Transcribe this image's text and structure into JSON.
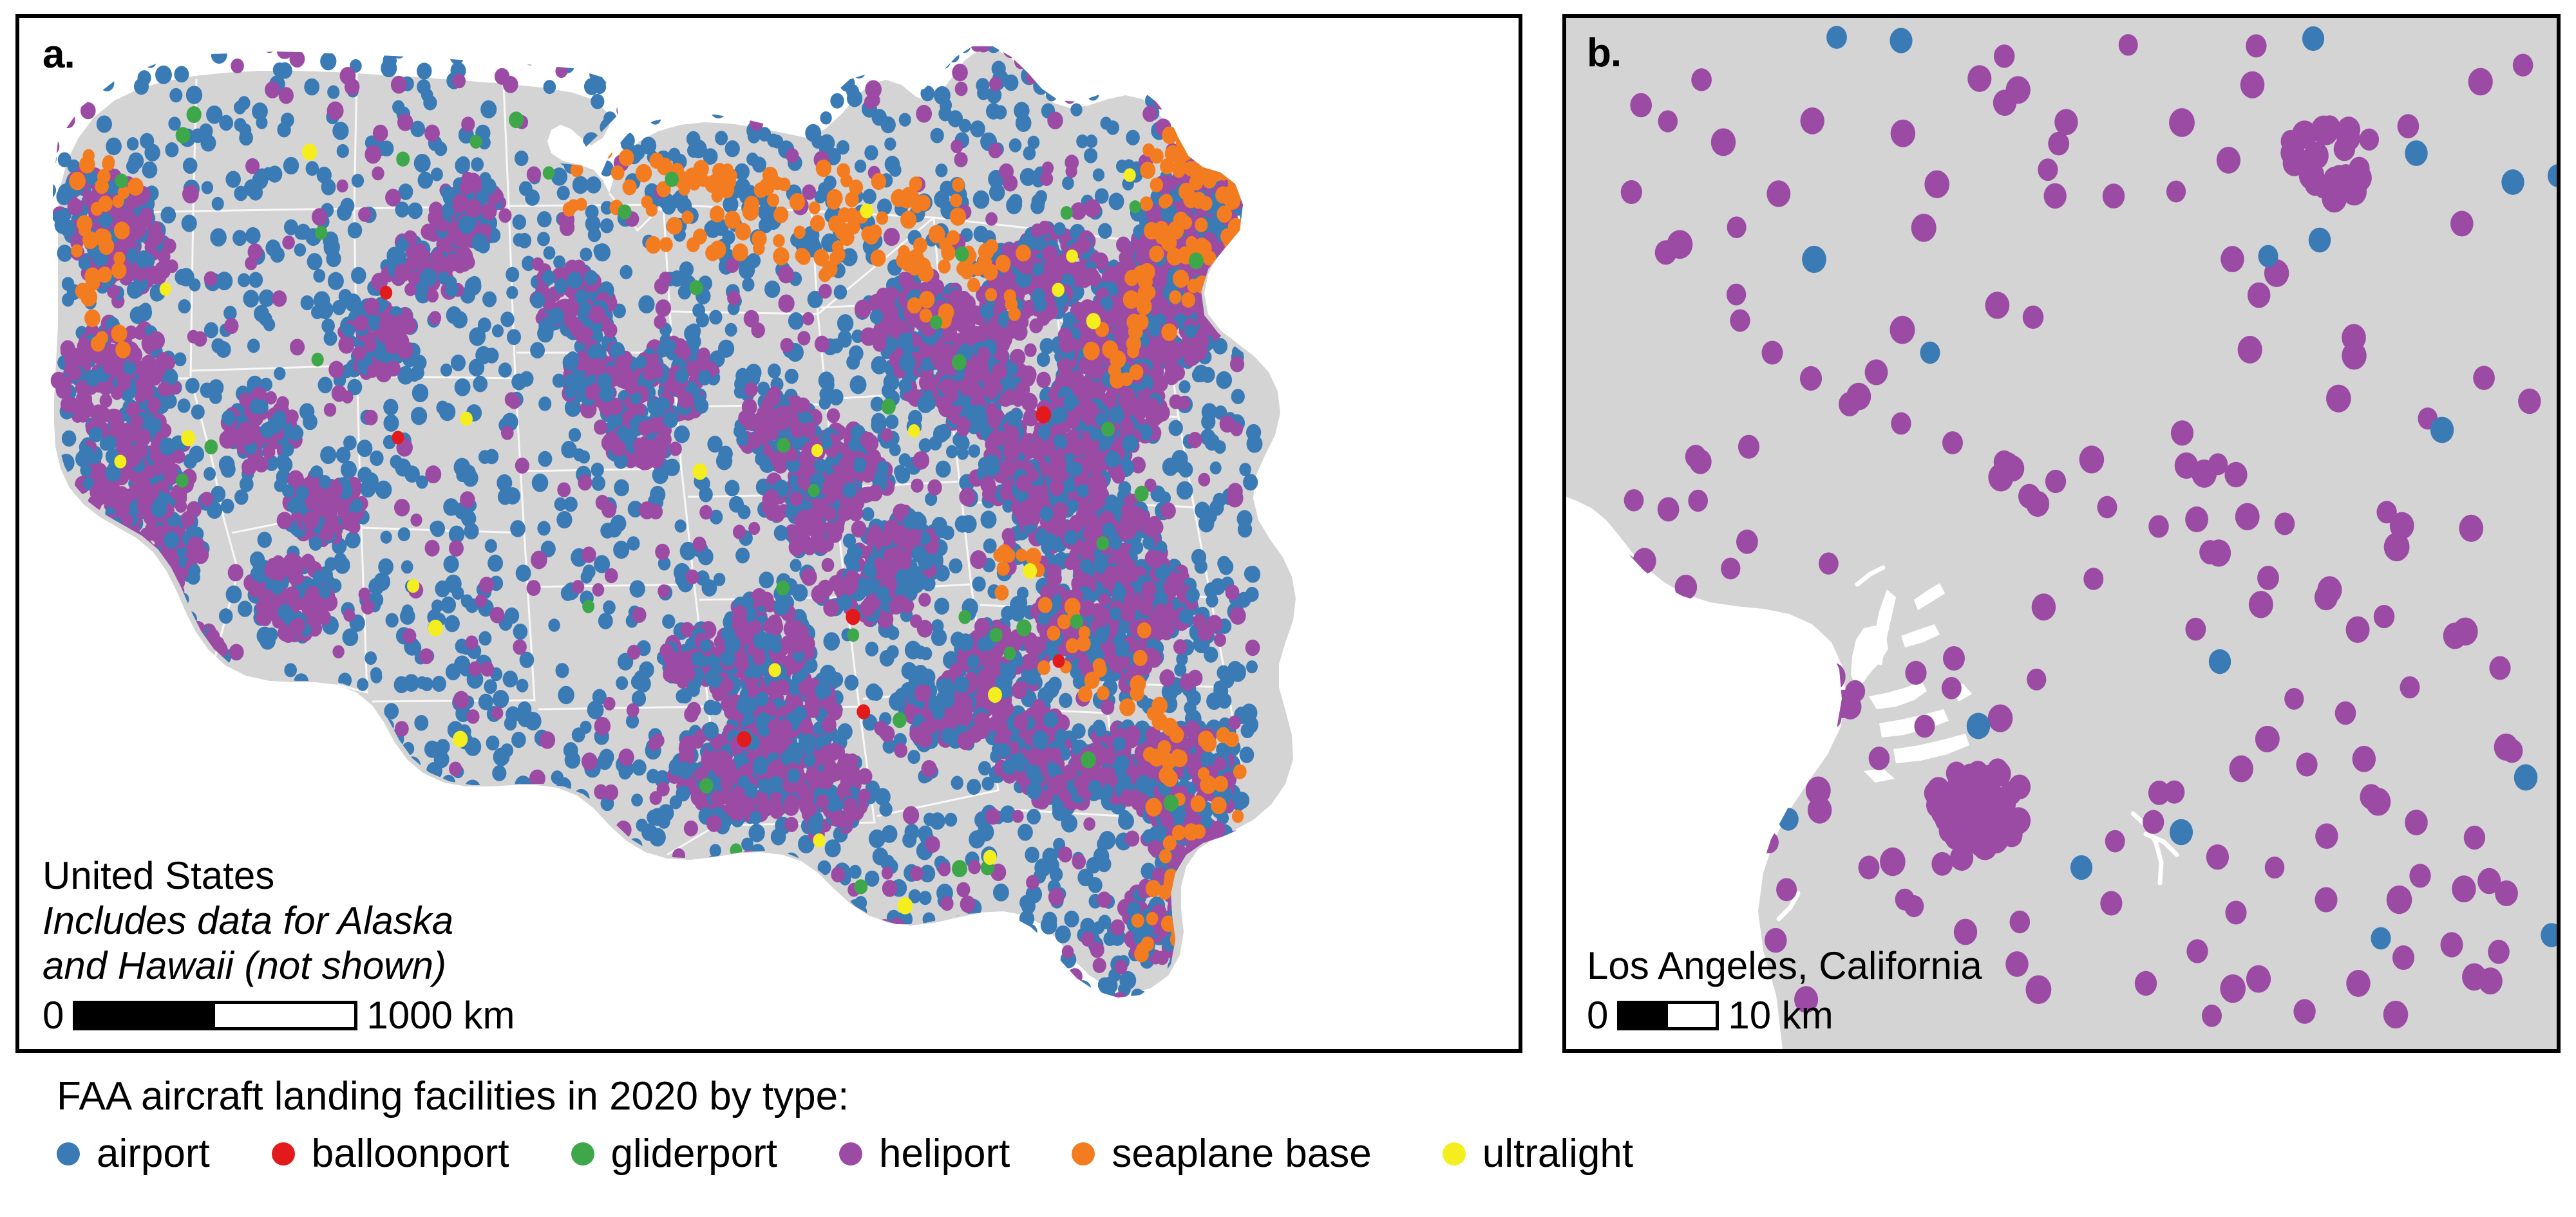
{
  "figure": {
    "panels": [
      {
        "letter": "a.",
        "region_label": "United States",
        "note_line_1": "Includes data for Alaska",
        "note_line_2": "and Hawaii (not shown)",
        "scalebar": {
          "min": "0",
          "max": "1000 km"
        }
      },
      {
        "letter": "b.",
        "region_label": "Los Angeles, California",
        "scalebar": {
          "min": "0",
          "max": "10 km"
        }
      }
    ]
  },
  "legend": {
    "title": "FAA aircraft landing facilities in 2020 by type:",
    "items": [
      {
        "label": "airport",
        "color": "#3a7ab5"
      },
      {
        "label": "balloonport",
        "color": "#e31a1c"
      },
      {
        "label": "gliderport",
        "color": "#3ea74a"
      },
      {
        "label": "heliport",
        "color": "#9c4ba5"
      },
      {
        "label": "seaplane base",
        "color": "#f47c20"
      },
      {
        "label": "ultralight",
        "color": "#f5ee1e"
      }
    ]
  },
  "colors": {
    "land": "#d4d4d4",
    "water": "#ffffff",
    "state_border": "#ffffff",
    "panel_border": "#000000",
    "background": "#ffffff",
    "text": "#000000"
  },
  "chart_data": {
    "type": "scatter",
    "title": "FAA aircraft landing facilities in 2020 by type",
    "description": "Two-panel dot-density map of FAA landing facilities. Panel a covers the contiguous United States; panel b is an inset of the Los Angeles, California metro area.",
    "categories": [
      "airport",
      "balloonport",
      "gliderport",
      "heliport",
      "seaplane base",
      "ultralight"
    ],
    "category_colors": [
      "#3a7ab5",
      "#e31a1c",
      "#3ea74a",
      "#9c4ba5",
      "#f47c20",
      "#f5ee1e"
    ],
    "panels": [
      {
        "id": "a",
        "extent_label": "United States",
        "note": "Includes data for Alaska and Hawaii (not shown)",
        "scale_km": 1000,
        "visual_summary": {
          "airport": "most numerous; spread evenly across the whole country, densest in the Midwest, Texas, Florida and the eastern seaboard",
          "heliport": "second most numerous; strongly clustered around major metros - Northeast corridor, Los Angeles, San Francisco Bay, Chicago, Texas Triangle, Florida",
          "seaplane base": "concentrated along Maine/New England coast, the Great Lakes, Minnesota lake country, Florida and Pacific Northwest",
          "gliderport": "sparse, scattered, a few dozen visible",
          "ultralight": "very sparse; isolated points in the Midwest and Southwest",
          "balloonport": "rarest; only a handful of points visible"
        }
      },
      {
        "id": "b",
        "extent_label": "Los Angeles, California",
        "scale_km": 10,
        "visual_summary": {
          "heliport": "dominant type; dense cluster over downtown Los Angeles with a scatter across the basin",
          "airport": "roughly a dozen points spread across the basin and inland valleys",
          "balloonport": "none visible",
          "gliderport": "none visible",
          "seaplane base": "none visible",
          "ultralight": "none visible"
        }
      }
    ],
    "legend_position": "below panels",
    "grid": false
  }
}
